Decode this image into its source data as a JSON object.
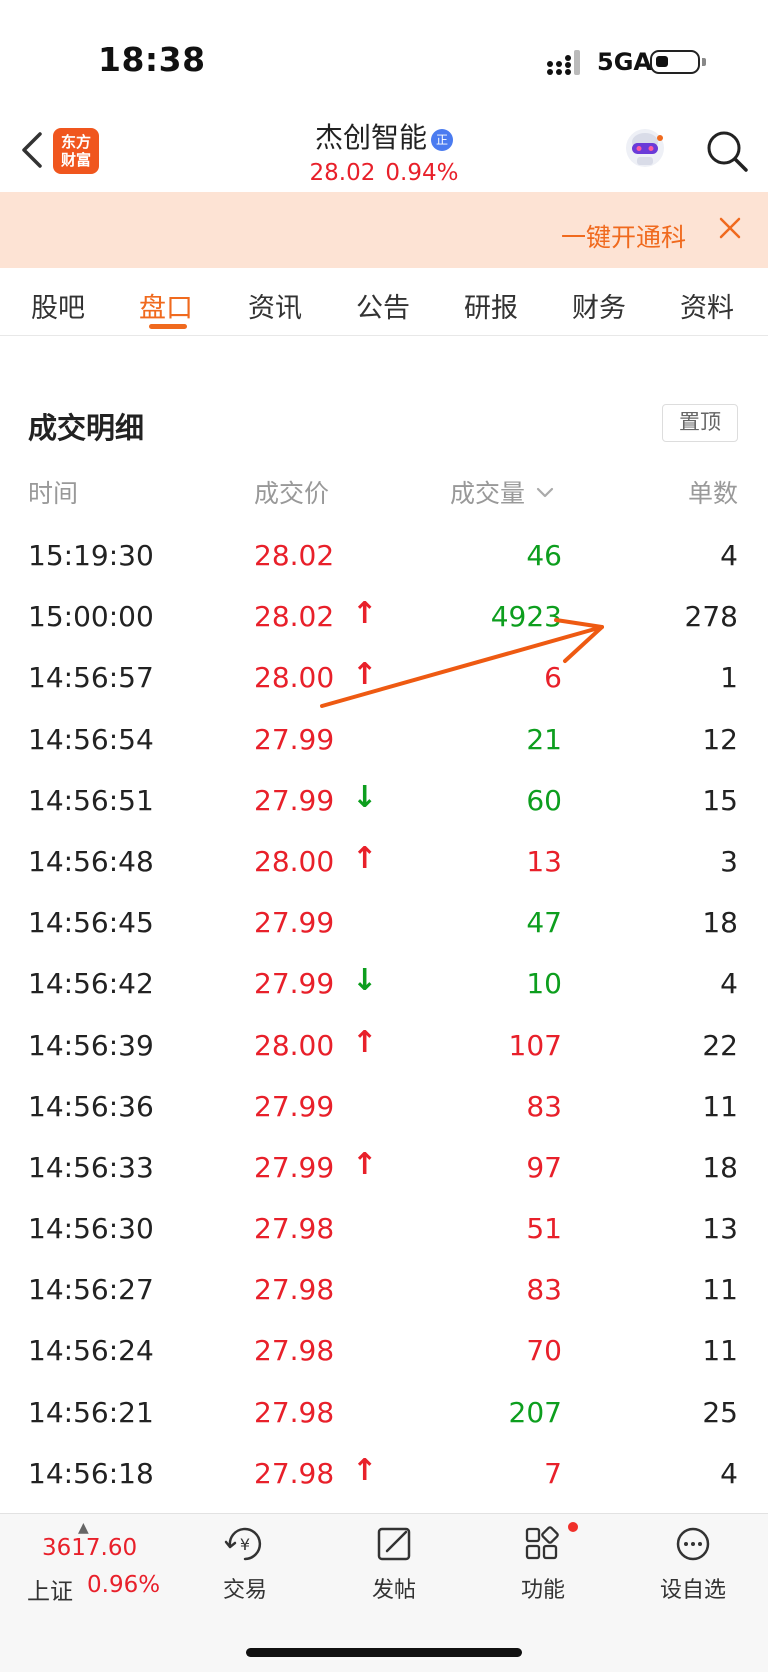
{
  "status_bar": {
    "time": "18:38",
    "network": "5GA"
  },
  "header": {
    "logo_line1": "东方",
    "logo_line2": "财富",
    "stock_name": "杰创智能",
    "badge": "正",
    "price": "28.02",
    "change_pct": "0.94%"
  },
  "banner": {
    "text": "一键开通科"
  },
  "tabs": [
    {
      "label": "股吧"
    },
    {
      "label": "盘口",
      "active": true
    },
    {
      "label": "资讯"
    },
    {
      "label": "公告"
    },
    {
      "label": "研报"
    },
    {
      "label": "财务"
    },
    {
      "label": "资料"
    }
  ],
  "section": {
    "title": "成交明细",
    "pin_button": "置顶"
  },
  "columns": {
    "time": "时间",
    "price": "成交价",
    "volume": "成交量",
    "count": "单数"
  },
  "trades": [
    {
      "time": "15:19:30",
      "price": "28.02",
      "arrow": "",
      "volume": "46",
      "vol_color": "green",
      "count": "4"
    },
    {
      "time": "15:00:00",
      "price": "28.02",
      "arrow": "↑",
      "volume": "4923",
      "vol_color": "green",
      "count": "278"
    },
    {
      "time": "14:56:57",
      "price": "28.00",
      "arrow": "↑",
      "volume": "6",
      "vol_color": "red",
      "count": "1"
    },
    {
      "time": "14:56:54",
      "price": "27.99",
      "arrow": "",
      "volume": "21",
      "vol_color": "green",
      "count": "12"
    },
    {
      "time": "14:56:51",
      "price": "27.99",
      "arrow": "↓",
      "volume": "60",
      "vol_color": "green",
      "count": "15"
    },
    {
      "time": "14:56:48",
      "price": "28.00",
      "arrow": "↑",
      "volume": "13",
      "vol_color": "red",
      "count": "3"
    },
    {
      "time": "14:56:45",
      "price": "27.99",
      "arrow": "",
      "volume": "47",
      "vol_color": "green",
      "count": "18"
    },
    {
      "time": "14:56:42",
      "price": "27.99",
      "arrow": "↓",
      "volume": "10",
      "vol_color": "green",
      "count": "4"
    },
    {
      "time": "14:56:39",
      "price": "28.00",
      "arrow": "↑",
      "volume": "107",
      "vol_color": "red",
      "count": "22"
    },
    {
      "time": "14:56:36",
      "price": "27.99",
      "arrow": "",
      "volume": "83",
      "vol_color": "red",
      "count": "11"
    },
    {
      "time": "14:56:33",
      "price": "27.99",
      "arrow": "↑",
      "volume": "97",
      "vol_color": "red",
      "count": "18"
    },
    {
      "time": "14:56:30",
      "price": "27.98",
      "arrow": "",
      "volume": "51",
      "vol_color": "red",
      "count": "13"
    },
    {
      "time": "14:56:27",
      "price": "27.98",
      "arrow": "",
      "volume": "83",
      "vol_color": "red",
      "count": "11"
    },
    {
      "time": "14:56:24",
      "price": "27.98",
      "arrow": "",
      "volume": "70",
      "vol_color": "red",
      "count": "11"
    },
    {
      "time": "14:56:21",
      "price": "27.98",
      "arrow": "",
      "volume": "207",
      "vol_color": "green",
      "count": "25"
    },
    {
      "time": "14:56:18",
      "price": "27.98",
      "arrow": "↑",
      "volume": "7",
      "vol_color": "red",
      "count": "4"
    }
  ],
  "bottom_bar": {
    "index_value": "3617.60",
    "index_name": "上证",
    "index_pct": "0.96%",
    "trade": "交易",
    "post": "发帖",
    "functions": "功能",
    "watchlist": "设自选"
  },
  "colors": {
    "accent": "#f06a1e",
    "up": "#e8202a",
    "down": "#0d9e1e"
  }
}
